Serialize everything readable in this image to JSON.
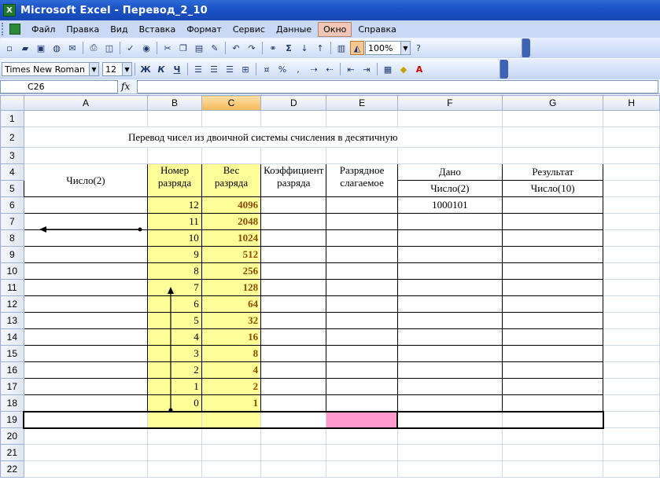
{
  "window": {
    "title": "Microsoft Excel - Перевод_2_10"
  },
  "menu": [
    "Файл",
    "Правка",
    "Вид",
    "Вставка",
    "Формат",
    "Сервис",
    "Данные",
    "Окно",
    "Справка"
  ],
  "menu_active": "Окно",
  "toolbar": {
    "zoom": "100%"
  },
  "format_toolbar": {
    "font": "Times New Roman",
    "size": "12",
    "bold": "Ж",
    "italic": "К",
    "underline": "Ч"
  },
  "formula_bar": {
    "cell_ref": "C26",
    "fx": "fx",
    "formula": ""
  },
  "columns": [
    "A",
    "B",
    "C",
    "D",
    "E",
    "F",
    "G",
    "H"
  ],
  "selected_column": "C",
  "rows": [
    "1",
    "2",
    "3",
    "4",
    "5",
    "6",
    "7",
    "8",
    "9",
    "10",
    "11",
    "12",
    "13",
    "14",
    "15",
    "16",
    "17",
    "18",
    "19",
    "20",
    "21",
    "22"
  ],
  "sheet": {
    "title": "Перевод чисел из двоичной системы счисления в десятичную",
    "a_header": "Число(2)",
    "b_header_1": "Номер",
    "b_header_2": "разряда",
    "c_header_1": "Вес",
    "c_header_2": "разряда",
    "d_header_1": "Коэффициент",
    "d_header_2": "разряда",
    "e_header_1": "Разрядное",
    "e_header_2": "слагаемое",
    "f_header": "Дано",
    "f_sub": "Число(2)",
    "g_header": "Результат",
    "g_sub": "Число(10)",
    "given_number": "1000101",
    "digit_positions": [
      "12",
      "11",
      "10",
      "9",
      "8",
      "7",
      "6",
      "5",
      "4",
      "3",
      "2",
      "1",
      "0"
    ],
    "weights": [
      "4096",
      "2048",
      "1024",
      "512",
      "256",
      "128",
      "64",
      "32",
      "16",
      "8",
      "4",
      "2",
      "1"
    ]
  }
}
